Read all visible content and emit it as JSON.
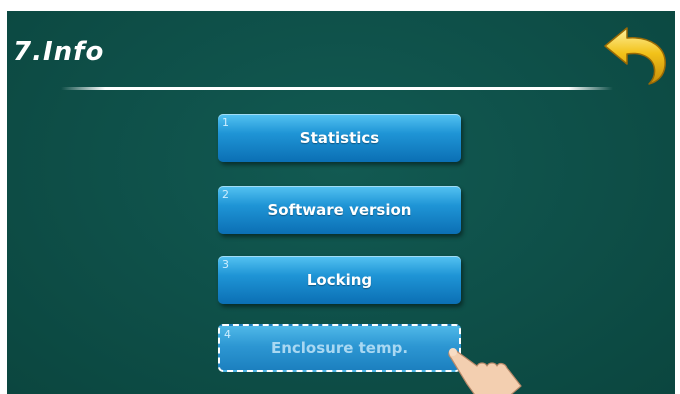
{
  "header": {
    "title": "7.Info",
    "back_icon": "back-arrow-icon"
  },
  "menu": {
    "items": [
      {
        "number": "1",
        "label": "Statistics"
      },
      {
        "number": "2",
        "label": "Software version"
      },
      {
        "number": "3",
        "label": "Locking"
      },
      {
        "number": "4",
        "label": "Enclosure temp."
      }
    ]
  },
  "colors": {
    "background": "#0e4f48",
    "button": "#1f95d6",
    "back_arrow": "#f2c21a"
  }
}
